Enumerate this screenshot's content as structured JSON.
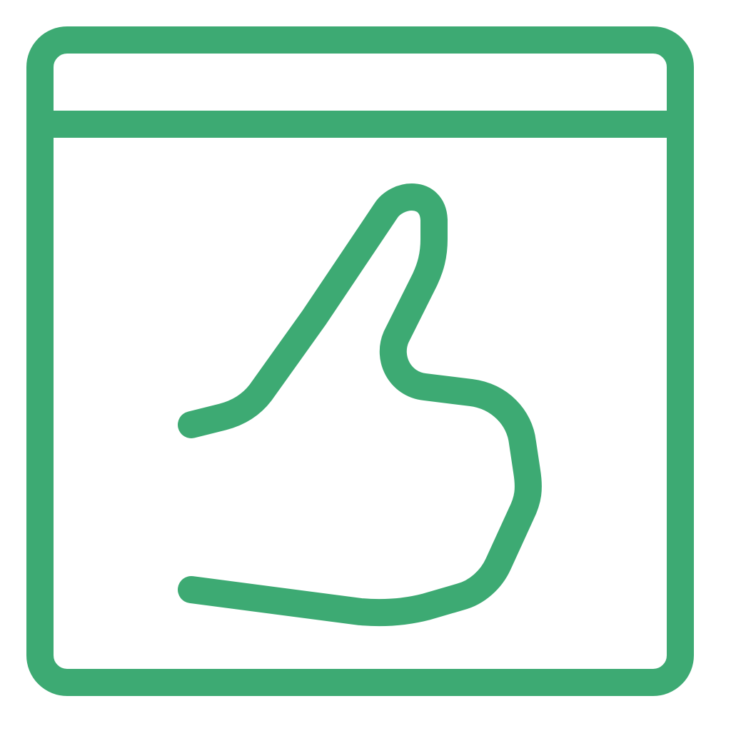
{
  "icon": {
    "name": "browser-window-thumbs-up-icon",
    "stroke_color": "#3DAA73",
    "background_color": "#FFFFFF"
  }
}
